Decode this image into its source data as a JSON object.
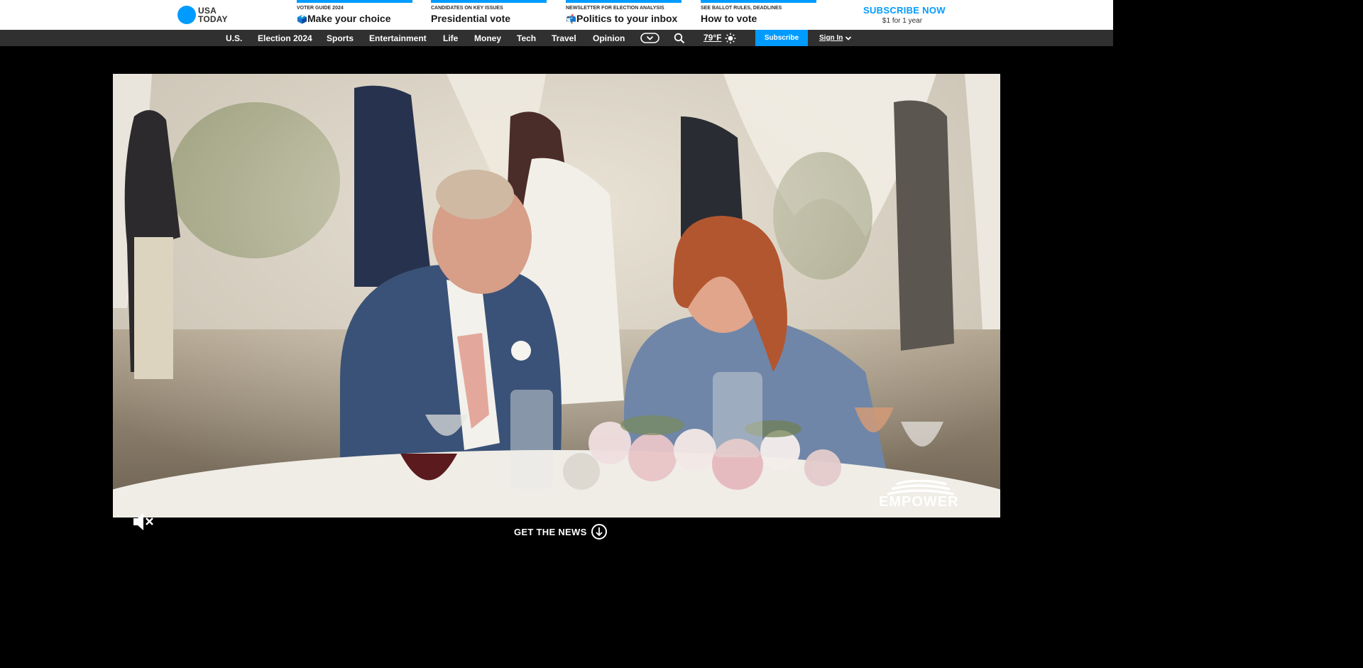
{
  "logo": {
    "line1": "USA",
    "line2": "TODAY"
  },
  "promos": [
    {
      "kicker": "VOTER GUIDE 2024",
      "emoji": "🗳️",
      "headline": "Make your choice"
    },
    {
      "kicker": "CANDIDATES ON KEY ISSUES",
      "emoji": "",
      "headline": "Presidential vote"
    },
    {
      "kicker": "NEWSLETTER FOR ELECTION ANALYSIS",
      "emoji": "📬",
      "headline": "Politics to your inbox"
    },
    {
      "kicker": "SEE BALLOT RULES, DEADLINES",
      "emoji": "",
      "headline": "How to vote"
    }
  ],
  "subscribe_promo": {
    "title": "SUBSCRIBE NOW",
    "subtitle": "$1 for 1 year"
  },
  "nav": {
    "items": [
      "U.S.",
      "Election 2024",
      "Sports",
      "Entertainment",
      "Life",
      "Money",
      "Tech",
      "Travel",
      "Opinion"
    ],
    "more_icon": "chevron-down-pill-icon",
    "search_icon": "search-icon",
    "weather": "79°F",
    "weather_icon": "sun-icon",
    "subscribe": "Subscribe",
    "signin": "Sign In"
  },
  "video": {
    "mute_icon": "speaker-muted-icon",
    "brand_logo": "EMPOWER"
  },
  "get_news": {
    "label": "GET THE NEWS",
    "icon": "arrow-down-circle-icon"
  },
  "colors": {
    "accent": "#009bff",
    "nav_bg": "#303030",
    "page_bg": "#000000"
  }
}
